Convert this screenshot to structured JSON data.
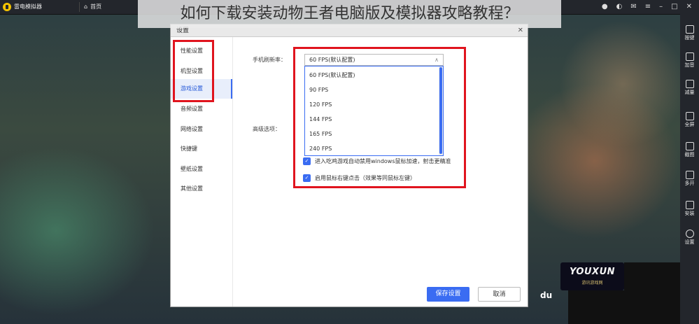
{
  "app": {
    "title": "雷电模拟器",
    "home_tab": "首页"
  },
  "overlay_title": "如何下载安装动物王者电脑版及模拟器攻略教程？",
  "dialog": {
    "title": "设置",
    "close_glyph": "✕",
    "sidebar": [
      {
        "label": "性能设置",
        "active": false
      },
      {
        "label": "机型设置",
        "active": false
      },
      {
        "label": "游戏设置",
        "active": true
      },
      {
        "label": "音频设置",
        "active": false
      },
      {
        "label": "网络设置",
        "active": false
      },
      {
        "label": "快捷键",
        "active": false
      },
      {
        "label": "壁纸设置",
        "active": false
      },
      {
        "label": "其他设置",
        "active": false
      }
    ],
    "fps": {
      "label": "手机刷新率：",
      "selected": "60 FPS(默认配置)",
      "options": [
        "60 FPS(默认配置)",
        "90 FPS",
        "120 FPS",
        "144 FPS",
        "165 FPS",
        "240 FPS"
      ]
    },
    "advanced_label": "高级选项：",
    "checkboxes": [
      {
        "label": "进入吃鸡游戏自动禁用windows鼠标加速，射击更精准",
        "checked": true
      },
      {
        "label": "启用鼠标右键点击（效果等同鼠标左键）",
        "checked": true
      }
    ],
    "save_button": "保存设置",
    "cancel_button": "取消"
  },
  "right_toolbar": [
    {
      "label": "按键",
      "icon": "keyboard-icon"
    },
    {
      "label": "加音",
      "icon": "volume-up-icon"
    },
    {
      "label": "减量",
      "icon": "volume-down-icon"
    },
    {
      "label": "全屏",
      "icon": "fullscreen-icon"
    },
    {
      "label": "截图",
      "icon": "scissors-icon"
    },
    {
      "label": "多开",
      "icon": "multi-instance-icon"
    },
    {
      "label": "安装",
      "icon": "apk-install-icon"
    },
    {
      "label": "设置",
      "icon": "gear-icon"
    }
  ],
  "watermark": {
    "text": "du",
    "brand": "YOUXUN",
    "brand_sub": "游讯游戏网"
  },
  "colors": {
    "accent": "#3a6cf2",
    "highlight_box": "#e0141e"
  }
}
